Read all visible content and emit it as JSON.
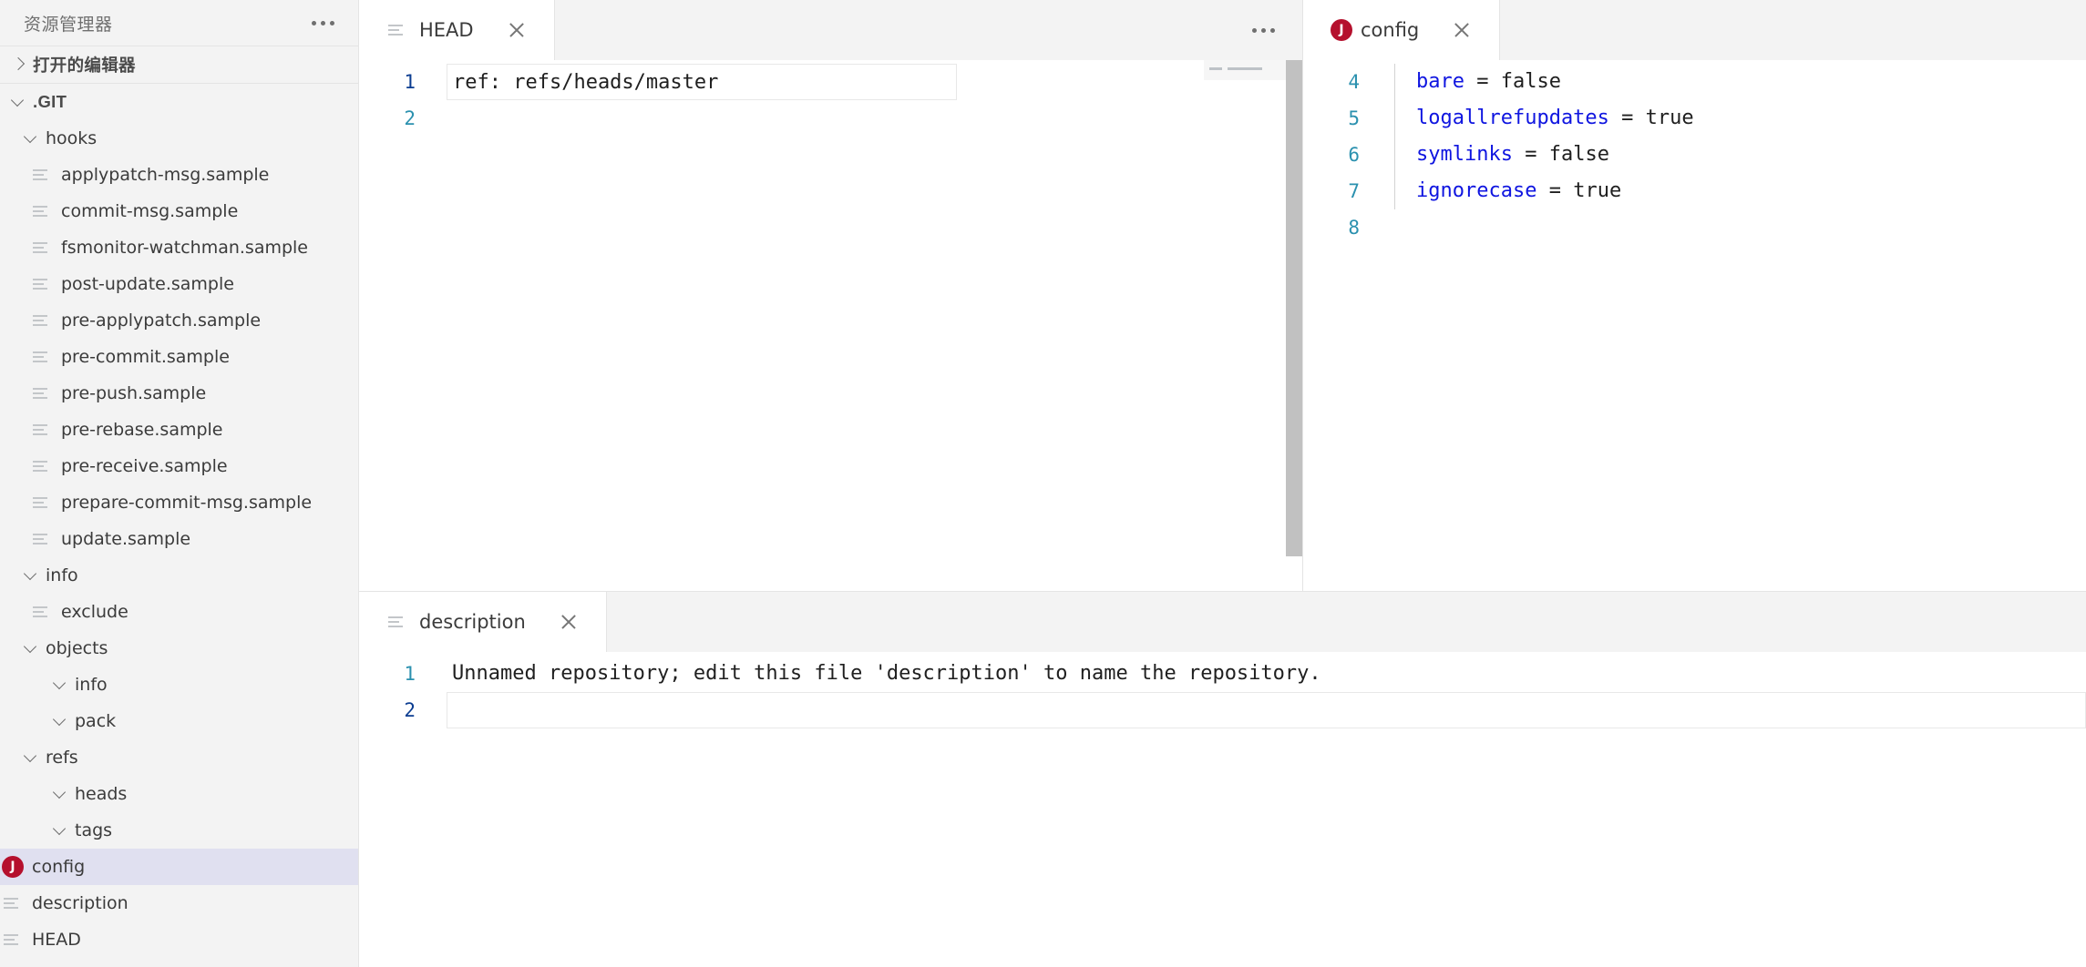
{
  "sidebar": {
    "title": "资源管理器",
    "more_label": "more-actions",
    "sections": [
      {
        "label": "打开的编辑器",
        "expanded": false,
        "name": "open-editors"
      },
      {
        "label": ".GIT",
        "expanded": true,
        "name": "git-root"
      }
    ],
    "tree": [
      {
        "label": "hooks",
        "type": "folder",
        "indent": 1,
        "expanded": true,
        "selected": false
      },
      {
        "label": "applypatch-msg.sample",
        "type": "file",
        "indent": 2,
        "selected": false
      },
      {
        "label": "commit-msg.sample",
        "type": "file",
        "indent": 2,
        "selected": false
      },
      {
        "label": "fsmonitor-watchman.sample",
        "type": "file",
        "indent": 2,
        "selected": false
      },
      {
        "label": "post-update.sample",
        "type": "file",
        "indent": 2,
        "selected": false
      },
      {
        "label": "pre-applypatch.sample",
        "type": "file",
        "indent": 2,
        "selected": false
      },
      {
        "label": "pre-commit.sample",
        "type": "file",
        "indent": 2,
        "selected": false
      },
      {
        "label": "pre-push.sample",
        "type": "file",
        "indent": 2,
        "selected": false
      },
      {
        "label": "pre-rebase.sample",
        "type": "file",
        "indent": 2,
        "selected": false
      },
      {
        "label": "pre-receive.sample",
        "type": "file",
        "indent": 2,
        "selected": false
      },
      {
        "label": "prepare-commit-msg.sample",
        "type": "file",
        "indent": 2,
        "selected": false
      },
      {
        "label": "update.sample",
        "type": "file",
        "indent": 2,
        "selected": false
      },
      {
        "label": "info",
        "type": "folder",
        "indent": 1,
        "expanded": true,
        "selected": false
      },
      {
        "label": "exclude",
        "type": "file",
        "indent": 2,
        "selected": false
      },
      {
        "label": "objects",
        "type": "folder",
        "indent": 1,
        "expanded": true,
        "selected": false
      },
      {
        "label": "info",
        "type": "folder",
        "indent": 2,
        "expanded": true,
        "selected": false
      },
      {
        "label": "pack",
        "type": "folder",
        "indent": 2,
        "expanded": true,
        "selected": false
      },
      {
        "label": "refs",
        "type": "folder",
        "indent": 1,
        "expanded": true,
        "selected": false
      },
      {
        "label": "heads",
        "type": "folder",
        "indent": 2,
        "expanded": true,
        "selected": false
      },
      {
        "label": "tags",
        "type": "folder",
        "indent": 2,
        "expanded": true,
        "selected": false
      },
      {
        "label": "config",
        "type": "json",
        "indent": 1,
        "selected": true
      },
      {
        "label": "description",
        "type": "file",
        "indent": 1,
        "selected": false
      },
      {
        "label": "HEAD",
        "type": "file",
        "indent": 1,
        "selected": false
      }
    ],
    "colors": {
      "selected_bg": "#e0e0f0",
      "panel_bg": "#f3f3f3",
      "json_icon_bg": "#b5102d"
    }
  },
  "editors": {
    "top_left": {
      "tab": {
        "label": "HEAD",
        "icon": "file-lines-icon",
        "active": true,
        "close_label": "×"
      },
      "more_label": "more-actions",
      "lines": [
        {
          "num": "1",
          "text": "ref: refs/heads/master",
          "current": true
        },
        {
          "num": "2",
          "text": "",
          "current": false
        }
      ],
      "scrollbar": {
        "visible": true,
        "thumb_color": "#c1c1c1"
      }
    },
    "top_right": {
      "tab": {
        "label": "config",
        "icon": "json-icon",
        "active": true,
        "close_label": "×"
      },
      "lines": [
        {
          "num": "4",
          "key": "bare",
          "eq": " = ",
          "value": "false",
          "current": false
        },
        {
          "num": "5",
          "key": "logallrefupdates",
          "eq": " = ",
          "value": "true",
          "current": false
        },
        {
          "num": "6",
          "key": "symlinks",
          "eq": " = ",
          "value": "false",
          "current": false
        },
        {
          "num": "7",
          "key": "ignorecase",
          "eq": " = ",
          "value": "true",
          "current": false
        },
        {
          "num": "8",
          "key": "",
          "eq": "",
          "value": "",
          "current": false
        }
      ]
    },
    "bottom": {
      "tab": {
        "label": "description",
        "icon": "file-lines-icon",
        "active": true,
        "close_label": "×"
      },
      "lines": [
        {
          "num": "1",
          "text": "Unnamed repository; edit this file 'description' to name the repository.",
          "current": false
        },
        {
          "num": "2",
          "text": "",
          "current": true
        }
      ]
    }
  },
  "colors": {
    "accent_blue": "#0f15e0",
    "linenum": "#2b91af",
    "linenum_current": "#0b3d91",
    "tab_active_bg": "#ffffff",
    "tabbar_bg": "#f3f3f3"
  }
}
